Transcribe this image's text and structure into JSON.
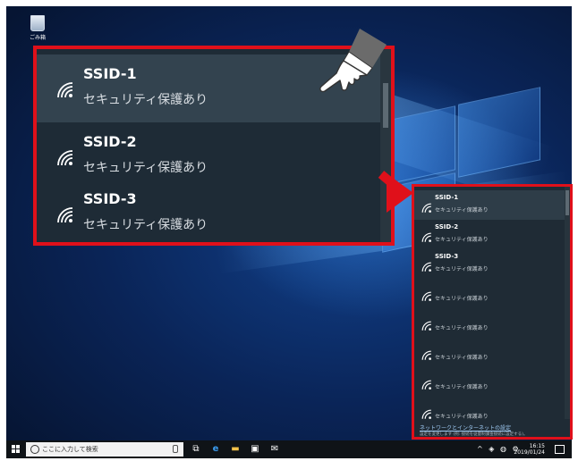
{
  "desktop": {
    "recycle_bin_label": "ごみ箱"
  },
  "zoom_panel": {
    "networks": [
      {
        "ssid": "SSID-1",
        "security": "セキュリティ保護あり",
        "selected": true
      },
      {
        "ssid": "SSID-2",
        "security": "セキュリティ保護あり",
        "selected": false
      },
      {
        "ssid": "SSID-3",
        "security": "セキュリティ保護あり",
        "selected": false
      }
    ]
  },
  "flyout": {
    "networks": [
      {
        "ssid": "SSID-1",
        "security": "セキュリティ保護あり"
      },
      {
        "ssid": "SSID-2",
        "security": "セキュリティ保護あり"
      },
      {
        "ssid": "SSID-3",
        "security": "セキュリティ保護あり"
      },
      {
        "ssid": "",
        "security": "セキュリティ保護あり"
      },
      {
        "ssid": "",
        "security": "セキュリティ保護あり"
      },
      {
        "ssid": "",
        "security": "セキュリティ保護あり"
      },
      {
        "ssid": "",
        "security": "セキュリティ保護あり"
      },
      {
        "ssid": "",
        "security": "セキュリティ保護あり"
      }
    ],
    "settings_link": "ネットワークとインターネットの設定",
    "settings_note": "設定を変更します (例: 接続を従量制課金接続に設定する)。"
  },
  "taskbar": {
    "search_placeholder": "ここに入力して検索",
    "time": "16:15",
    "date": "2019/01/24"
  },
  "colors": {
    "highlight_border": "#e0101a",
    "flyout_bg": "#1f2b35",
    "taskbar_bg": "#0f1317"
  },
  "icons": {
    "wifi": "wifi-signal-icon",
    "start": "windows-logo-icon",
    "search": "search-icon",
    "pointer": "pointing-hand-icon"
  }
}
